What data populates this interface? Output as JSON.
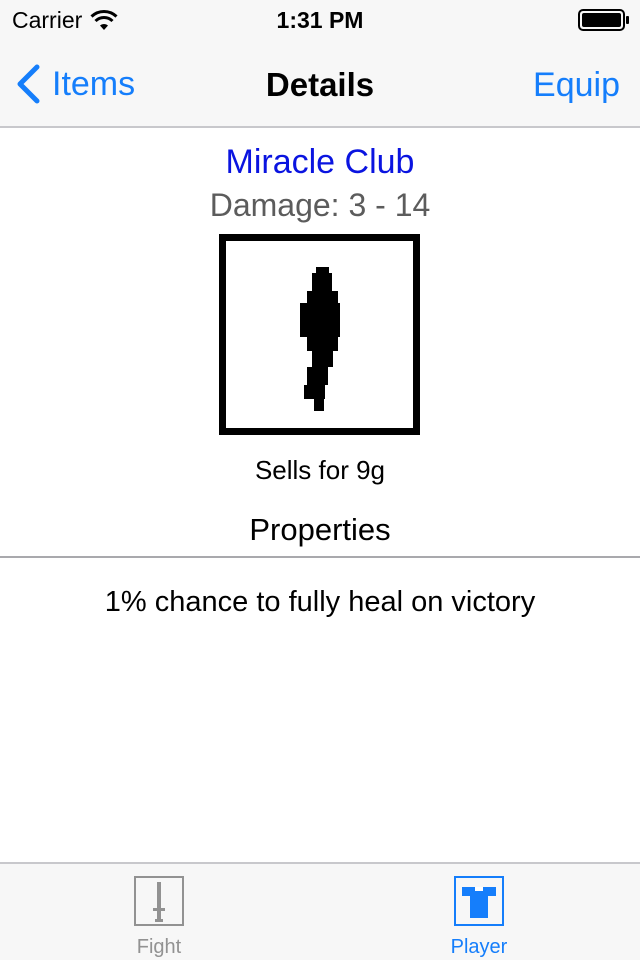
{
  "status_bar": {
    "carrier": "Carrier",
    "time": "1:31 PM"
  },
  "nav_bar": {
    "back_label": "Items",
    "title": "Details",
    "action_label": "Equip"
  },
  "item": {
    "name": "Miracle Club",
    "damage": "Damage: 3 - 14",
    "image_icon": "club-icon",
    "sell_price": "Sells for 9g"
  },
  "properties": {
    "heading": "Properties",
    "items": [
      "1% chance to fully heal on victory"
    ]
  },
  "tab_bar": {
    "tabs": [
      {
        "label": "Fight",
        "icon": "sword-icon",
        "selected": false
      },
      {
        "label": "Player",
        "icon": "shirt-icon",
        "selected": true
      }
    ]
  },
  "colors": {
    "accent": "#157efb",
    "item_name": "#0a14e0",
    "secondary_text": "#5c5c5c",
    "inactive_tab": "#929292",
    "bar_background": "#f7f7f7"
  }
}
